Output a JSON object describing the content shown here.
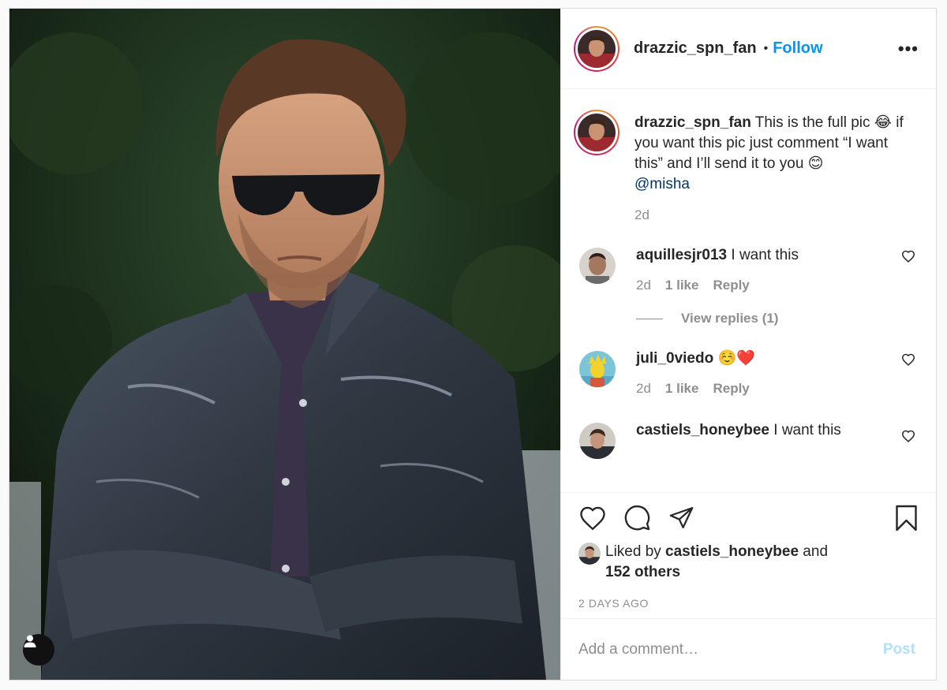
{
  "post": {
    "author": "drazzic_spn_fan",
    "header_separator": "•",
    "follow_label": "Follow",
    "more_label": "•••"
  },
  "caption": {
    "username": "drazzic_spn_fan",
    "text_part1": " This is the full pic ",
    "emoji1": "😂",
    "text_part2": " if you want this pic just comment “I want this” and I’ll send it to you ",
    "emoji2": "😊",
    "mention": "@misha",
    "time": "2d"
  },
  "comments": [
    {
      "username": "aquillesjr013",
      "text": " I want this",
      "time": "2d",
      "likes": "1 like",
      "reply_label": "Reply",
      "view_replies": "View replies (1)"
    },
    {
      "username": "juli_0viedo",
      "text": " ☺️❤️",
      "time": "2d",
      "likes": "1 like",
      "reply_label": "Reply"
    },
    {
      "username": "castiels_honeybee",
      "text": " I want this"
    }
  ],
  "likes": {
    "prefix": "Liked by ",
    "user": "castiels_honeybee",
    "middle": " and",
    "others": "152 others"
  },
  "timestamp": "2 DAYS AGO",
  "add_comment": {
    "placeholder": "Add a comment…",
    "post_label": "Post"
  },
  "icons": {
    "like": "heart-icon",
    "comment": "comment-bubble-icon",
    "share": "paper-plane-icon",
    "save": "bookmark-icon",
    "user_tags": "person-icon",
    "more": "ellipsis-icon"
  },
  "colors": {
    "link_blue": "#0095f6",
    "mention_blue": "#00376b",
    "muted_gray": "#8e8e8e",
    "post_disabled": "#b2dffc"
  }
}
